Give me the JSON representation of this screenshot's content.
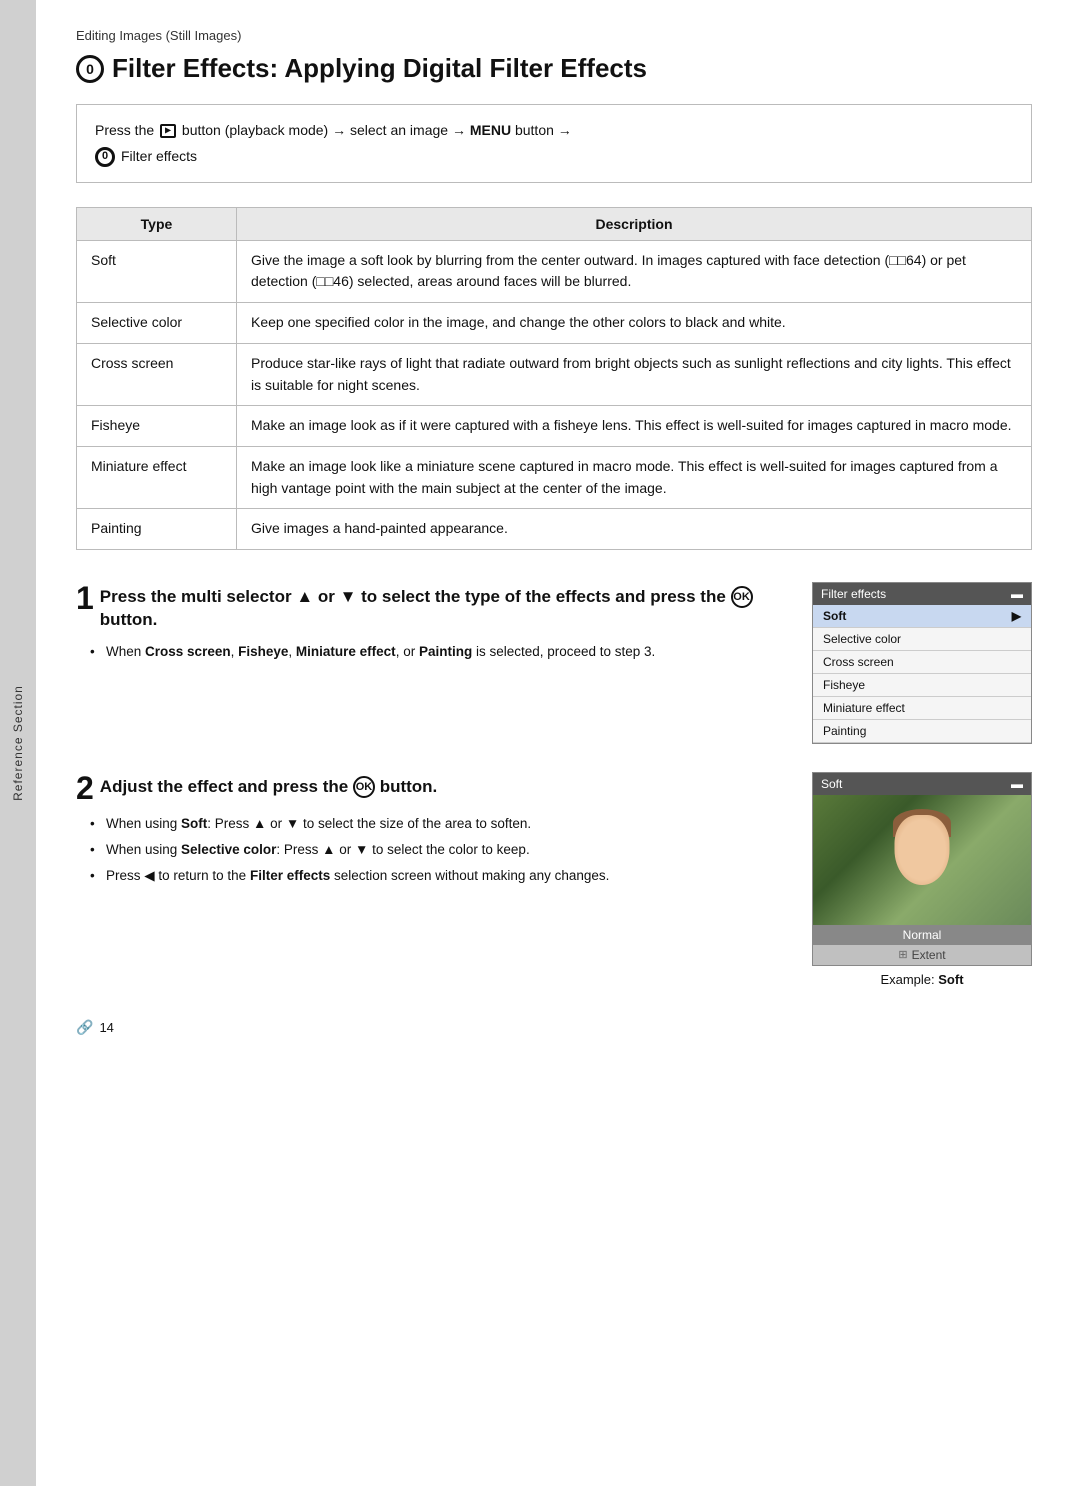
{
  "breadcrumb": "Editing Images (Still Images)",
  "page_title": "Filter Effects: Applying Digital Filter Effects",
  "nav_instruction": "Press the  button (playback mode) → select an image → MENU button →",
  "nav_link": "Filter effects",
  "table": {
    "col1_header": "Type",
    "col2_header": "Description",
    "rows": [
      {
        "type": "Soft",
        "description": "Give the image a soft look by blurring from the center outward. In images captured with face detection (□□64) or pet detection (□□46) selected, areas around faces will be blurred."
      },
      {
        "type": "Selective color",
        "description": "Keep one specified color in the image, and change the other colors to black and white."
      },
      {
        "type": "Cross screen",
        "description": "Produce star-like rays of light that radiate outward from bright objects such as sunlight reflections and city lights. This effect is suitable for night scenes."
      },
      {
        "type": "Fisheye",
        "description": "Make an image look as if it were captured with a fisheye lens. This effect is well-suited for images captured in macro mode."
      },
      {
        "type": "Miniature effect",
        "description": "Make an image look like a miniature scene captured in macro mode. This effect is well-suited for images captured from a high vantage point with the main subject at the center of the image."
      },
      {
        "type": "Painting",
        "description": "Give images a hand-painted appearance."
      }
    ]
  },
  "step1": {
    "number": "1",
    "heading_text": "Press the multi selector ▲ or ▼ to select the type of the effects and press the  button.",
    "bullet1": "When Cross screen, Fisheye, Miniature effect, or Painting is selected, proceed to step 3."
  },
  "step1_panel": {
    "title": "Filter effects",
    "items": [
      "Soft",
      "Selective color",
      "Cross screen",
      "Fisheye",
      "Miniature effect",
      "Painting"
    ],
    "selected": "Soft"
  },
  "step2": {
    "number": "2",
    "heading_text": "Adjust the effect and press the  button.",
    "bullet1": "When using Soft: Press ▲ or ▼ to select the size of the area to soften.",
    "bullet2": "When using Selective color: Press ▲ or ▼ to select the color to keep.",
    "bullet3": "Press ◀ to return to the Filter effects selection screen without making any changes."
  },
  "step2_panel": {
    "title": "Soft",
    "normal_label": "Normal",
    "extent_label": "Extent",
    "example_label": "Example: Soft"
  },
  "sidebar_label": "Reference Section",
  "footer_page": "14"
}
